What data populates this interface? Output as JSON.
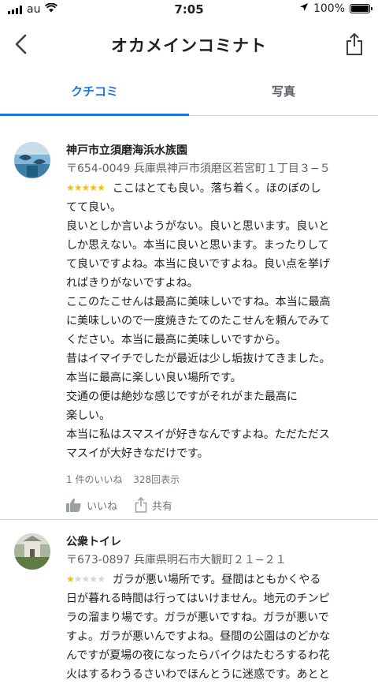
{
  "status_bar": {
    "carrier": "au",
    "time": "7:05",
    "battery": "100%",
    "battery_level": 1.0
  },
  "header": {
    "title": "オカメインコミナト"
  },
  "tabs": [
    {
      "label": "クチコミ"
    },
    {
      "label": "写真"
    }
  ],
  "reviews": [
    {
      "place": "神戸市立須磨海浜水族園",
      "address": "〒654-0049 兵庫県神戸市須磨区若宮町１丁目３−５",
      "rating": 5,
      "lines": [
        "ここはとても良い。落ち着く。ほのぼのし",
        "てて良い。",
        "良いとしか言いようがない。良いと思います。良いと",
        "しか思えない。本当に良いと思います。まったりして",
        "て良いですよね。本当に良いですよね。良い点を挙げ",
        "ればきりがないですよね。",
        "ここのたこせんは最高に美味しいですね。本当に最高",
        "に美味しいので一度焼きたてのたこせんを頼んでみて",
        "ください。本当に最高に美味しいですから。",
        "昔はイマイチでしたが最近は少し垢抜けてきました。",
        "本当に最高に楽しい良い場所です。",
        "交通の便は絶妙な感じですがそれがまた最高に",
        "楽しい。",
        "本当に私はスマスイが好きなんですよね。ただただス",
        "マスイが大好きなだけです。"
      ],
      "likes_text": "1 件のいいね",
      "views_text": "328回表示",
      "like_label": "いいね",
      "share_label": "共有"
    },
    {
      "place": "公衆トイレ",
      "address": "〒673-0897 兵庫県明石市大観町２１−２１",
      "rating": 1,
      "lines": [
        "ガラが悪い場所です。昼間はともかくやる",
        "日が暮れる時間は行ってはいけません。地元のチンピ",
        "ラの溜まり場です。ガラが悪いですね。ガラが悪いで",
        "すよ。ガラが悪いんですよね。昼間の公園はのどかな",
        "んですが夏場の夜になったらバイクはたむろするわ花",
        "火はするわうるさいわでほんとうに迷惑です。あとと"
      ]
    }
  ]
}
